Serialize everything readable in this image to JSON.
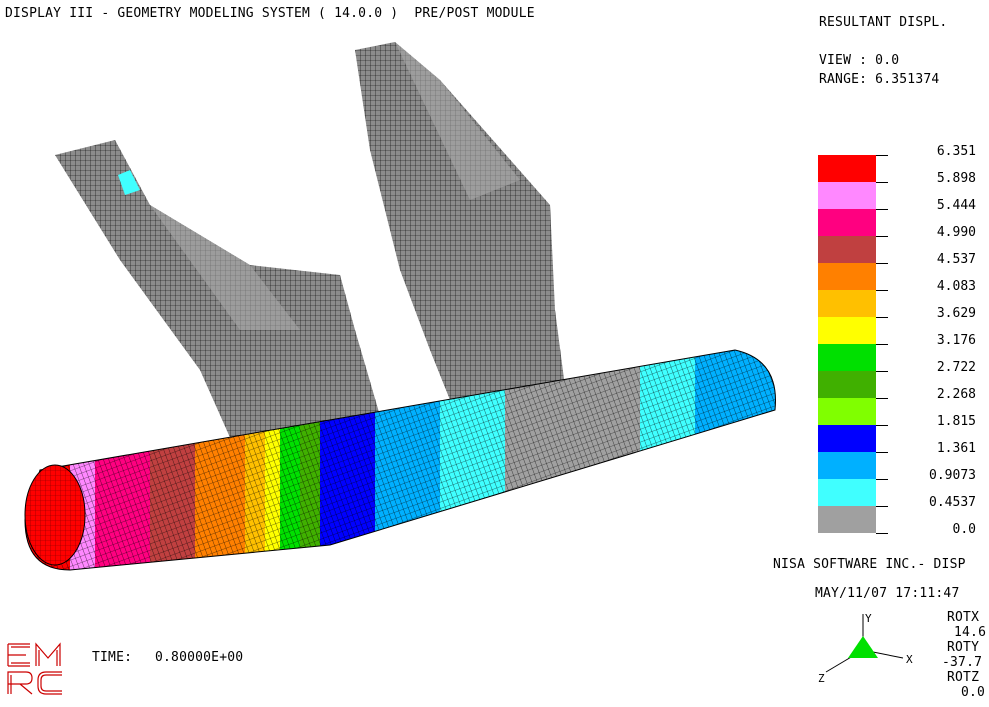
{
  "header": {
    "title": "DISPLAY III - GEOMETRY MODELING SYSTEM ( 14.0.0 )  PRE/POST MODULE"
  },
  "result_panel": {
    "result_type": "RESULTANT DISPL.",
    "view_line": "VIEW : 0.0",
    "range_line": "RANGE: 6.351374"
  },
  "legend": {
    "values": [
      "6.351",
      "5.898",
      "5.444",
      "4.990",
      "4.537",
      "4.083",
      "3.629",
      "3.176",
      "2.722",
      "2.268",
      "1.815",
      "1.361",
      "0.9073",
      "0.4537",
      "0.0"
    ],
    "colors": [
      "#ff0000",
      "#ff88ff",
      "#ff0080",
      "#c04040",
      "#ff8000",
      "#ffc000",
      "#ffff00",
      "#00e000",
      "#40b000",
      "#80ff00",
      "#0000ff",
      "#00b0ff",
      "#40ffff",
      "#a0a0a0"
    ]
  },
  "footer": {
    "company": "NISA SOFTWARE INC.- DISP",
    "datetime": "MAY/11/07 17:11:47",
    "time_label": "TIME:",
    "time_value": "0.80000E+00",
    "rotations": [
      {
        "label": "ROTX",
        "value": "14.6"
      },
      {
        "label": "ROTY",
        "value": "-37.7"
      },
      {
        "label": "ROTZ",
        "value": "0.0"
      }
    ],
    "axes": {
      "x": "X",
      "y": "Y",
      "z": "Z"
    },
    "logo": "EMRC"
  }
}
